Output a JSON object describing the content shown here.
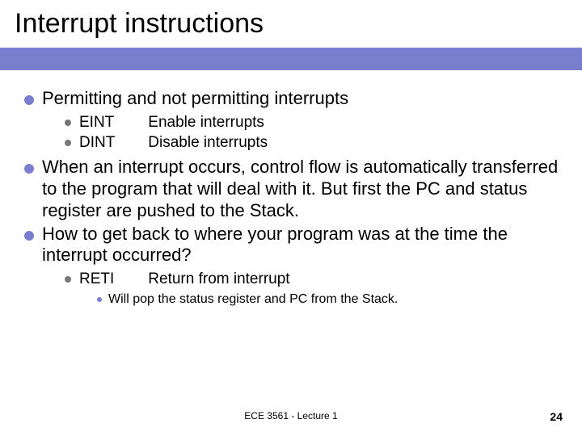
{
  "title": "Interrupt instructions",
  "bullets": {
    "b1": "Permitting and not permitting interrupts",
    "b1a_mn": "EINT",
    "b1a_desc": "Enable interrupts",
    "b1b_mn": "DINT",
    "b1b_desc": "Disable interrupts",
    "b2": "When an interrupt occurs, control flow is automatically transferred to the program that will deal with it.  But first the PC and status register are pushed to the Stack.",
    "b3": "How to get back to where your program was at the time the interrupt occurred?",
    "b3a_mn": "RETI",
    "b3a_desc": "Return from interrupt",
    "b3a1": "Will pop the status register and PC from the Stack."
  },
  "footer": "ECE 3561 - Lecture 1",
  "page": "24"
}
